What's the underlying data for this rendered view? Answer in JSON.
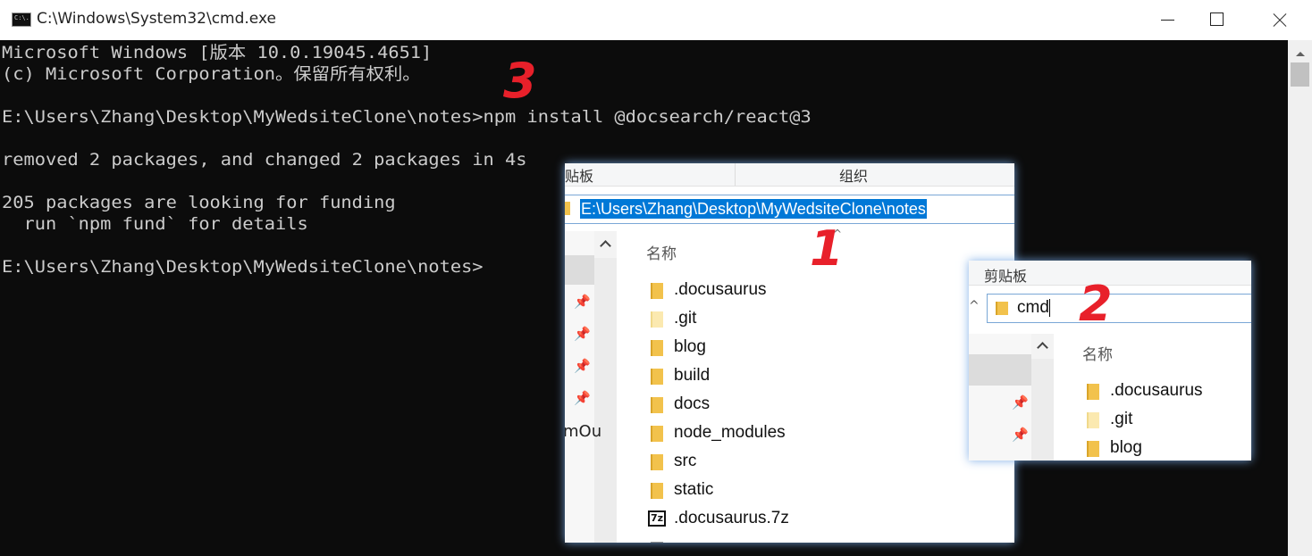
{
  "window": {
    "title": "C:\\Windows\\System32\\cmd.exe",
    "icon": "cmd-icon",
    "icon_text": "C:\\."
  },
  "console": {
    "lines": [
      "Microsoft Windows [版本 10.0.19045.4651]",
      "(c) Microsoft Corporation。保留所有权利。",
      "E:\\Users\\Zhang\\Desktop\\MyWedsiteClone\\notes>npm install @docsearch/react@3",
      "removed 2 packages, and changed 2 packages in 4s",
      "205 packages are looking for funding",
      "  run `npm fund` for details",
      "E:\\Users\\Zhang\\Desktop\\MyWedsiteClone\\notes>"
    ]
  },
  "annotations": {
    "step1": "1",
    "step2": "2",
    "step3": "3"
  },
  "explorer1": {
    "ribbon_clipboard": "贴板",
    "ribbon_organize": "组织",
    "address_path": "E:\\Users\\Zhang\\Desktop\\MyWedsiteClone\\notes",
    "column_name": "名称",
    "nav_partial_text": "mOu",
    "items": [
      {
        "name": ".docusaurus",
        "icon": "folder-icon"
      },
      {
        "name": ".git",
        "icon": "folder-icon"
      },
      {
        "name": "blog",
        "icon": "folder-icon"
      },
      {
        "name": "build",
        "icon": "folder-icon"
      },
      {
        "name": "docs",
        "icon": "folder-icon"
      },
      {
        "name": "node_modules",
        "icon": "folder-icon"
      },
      {
        "name": "src",
        "icon": "folder-icon"
      },
      {
        "name": "static",
        "icon": "folder-icon"
      },
      {
        "name": ".docusaurus.7z",
        "icon": "7z-archive-icon"
      }
    ]
  },
  "explorer2": {
    "ribbon_clipboard": "剪贴板",
    "address_input": "cmd",
    "column_name": "名称",
    "items": [
      {
        "name": ".docusaurus",
        "icon": "folder-icon"
      },
      {
        "name": ".git",
        "icon": "folder-icon"
      },
      {
        "name": "blog",
        "icon": "folder-icon"
      }
    ]
  },
  "icons": {
    "pin": "📌",
    "zip_label": "7z"
  },
  "colors": {
    "annotation": "#e8202a",
    "selection": "#0078d7",
    "folder": "#f2c24c"
  }
}
